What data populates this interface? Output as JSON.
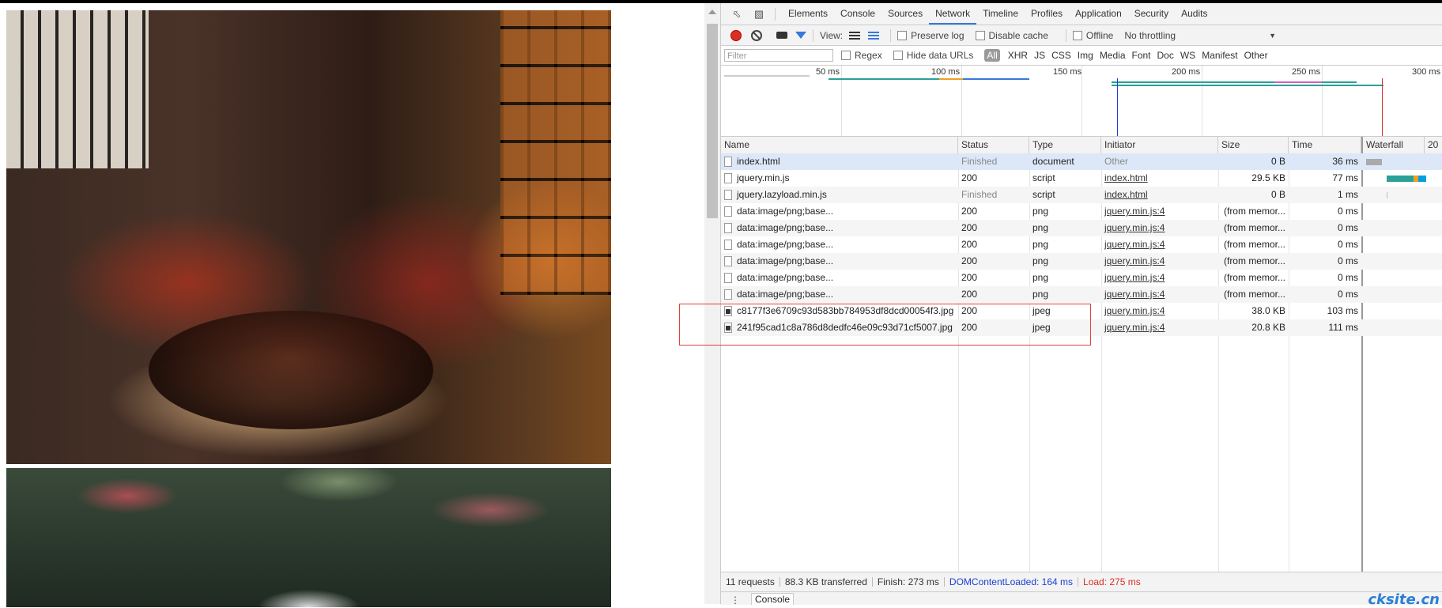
{
  "devtools": {
    "tabs": [
      "Elements",
      "Console",
      "Sources",
      "Network",
      "Timeline",
      "Profiles",
      "Application",
      "Security",
      "Audits"
    ],
    "active_tab": "Network",
    "toolbar": {
      "view_label": "View:",
      "preserve_log": "Preserve log",
      "disable_cache": "Disable cache",
      "offline": "Offline",
      "throttling": "No throttling"
    },
    "filterbar": {
      "placeholder": "Filter",
      "regex": "Regex",
      "hide_data_urls": "Hide data URLs",
      "types": [
        "All",
        "XHR",
        "JS",
        "CSS",
        "Img",
        "Media",
        "Font",
        "Doc",
        "WS",
        "Manifest",
        "Other"
      ]
    },
    "overview_ticks": [
      "50 ms",
      "100 ms",
      "150 ms",
      "200 ms",
      "250 ms",
      "300 ms"
    ],
    "columns": [
      "Name",
      "Status",
      "Type",
      "Initiator",
      "Size",
      "Time",
      "Waterfall",
      "20"
    ],
    "rows": [
      {
        "name": "index.html",
        "status": "Finished",
        "type": "document",
        "initiator": "Other",
        "size": "0 B",
        "time": "36 ms",
        "icon": "document-icon"
      },
      {
        "name": "jquery.min.js",
        "status": "200",
        "type": "script",
        "initiator": "index.html",
        "size": "29.5 KB",
        "time": "77 ms",
        "icon": "document-icon"
      },
      {
        "name": "jquery.lazyload.min.js",
        "status": "Finished",
        "type": "script",
        "initiator": "index.html",
        "size": "0 B",
        "time": "1 ms",
        "icon": "document-icon"
      },
      {
        "name": "data:image/png;base...",
        "status": "200",
        "type": "png",
        "initiator": "jquery.min.js:4",
        "size": "(from memor...",
        "time": "0 ms",
        "icon": "document-icon"
      },
      {
        "name": "data:image/png;base...",
        "status": "200",
        "type": "png",
        "initiator": "jquery.min.js:4",
        "size": "(from memor...",
        "time": "0 ms",
        "icon": "document-icon"
      },
      {
        "name": "data:image/png;base...",
        "status": "200",
        "type": "png",
        "initiator": "jquery.min.js:4",
        "size": "(from memor...",
        "time": "0 ms",
        "icon": "document-icon"
      },
      {
        "name": "data:image/png;base...",
        "status": "200",
        "type": "png",
        "initiator": "jquery.min.js:4",
        "size": "(from memor...",
        "time": "0 ms",
        "icon": "document-icon"
      },
      {
        "name": "data:image/png;base...",
        "status": "200",
        "type": "png",
        "initiator": "jquery.min.js:4",
        "size": "(from memor...",
        "time": "0 ms",
        "icon": "document-icon"
      },
      {
        "name": "data:image/png;base...",
        "status": "200",
        "type": "png",
        "initiator": "jquery.min.js:4",
        "size": "(from memor...",
        "time": "0 ms",
        "icon": "document-icon"
      },
      {
        "name": "c8177f3e6709c93d583bb784953df8dcd00054f3.jpg",
        "status": "200",
        "type": "jpeg",
        "initiator": "jquery.min.js:4",
        "size": "38.0 KB",
        "time": "103 ms",
        "icon": "image-icon"
      },
      {
        "name": "241f95cad1c8a786d8dedfc46e09c93d71cf5007.jpg",
        "status": "200",
        "type": "jpeg",
        "initiator": "jquery.min.js:4",
        "size": "20.8 KB",
        "time": "111 ms",
        "icon": "image-icon"
      }
    ],
    "statusbar": {
      "requests": "11 requests",
      "transferred": "88.3 KB transferred",
      "finish": "Finish: 273 ms",
      "dcl": "DOMContentLoaded: 164 ms",
      "load": "Load: 275 ms"
    },
    "drawer_tab": "Console"
  },
  "watermark": "cksite.cn",
  "colors": {
    "accent": "#3879d9",
    "record": "#d93025",
    "dcl": "#1a3fd1",
    "load": "#d93025",
    "highlight_box": "#e0403a"
  }
}
